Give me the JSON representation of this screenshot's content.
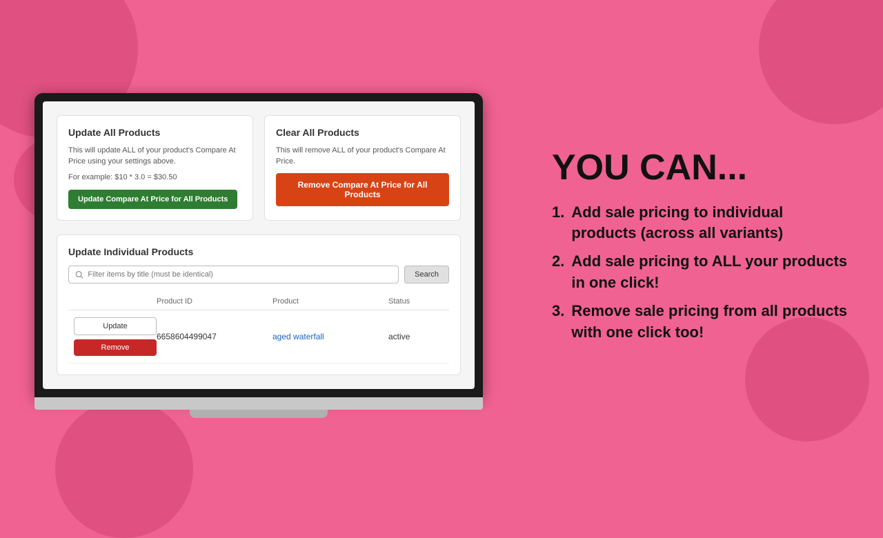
{
  "background": {
    "color": "#f06292"
  },
  "left": {
    "update_all": {
      "title": "Update All Products",
      "description": "This will update ALL of your product's Compare At Price using your settings above.",
      "example": "For example: $10 * 3.0 = $30.50",
      "button_label": "Update Compare At Price for All Products"
    },
    "clear_all": {
      "title": "Clear All Products",
      "description": "This will remove ALL of your product's Compare At Price.",
      "button_label": "Remove Compare At Price for All Products"
    },
    "individual": {
      "title": "Update Individual Products",
      "search_placeholder": "Filter items by title (must be identical)",
      "search_button": "Search",
      "columns": {
        "col1": "",
        "col2": "Product ID",
        "col3": "Product",
        "col4": "Status"
      },
      "rows": [
        {
          "update_label": "Update",
          "remove_label": "Remove",
          "product_id": "6658604499047",
          "product_name": "aged waterfall",
          "product_link": "#",
          "status": "active"
        }
      ]
    }
  },
  "right": {
    "heading": "YOU CAN...",
    "items": [
      "Add sale pricing to individual products (across all variants)",
      "Add sale pricing to ALL your products in one click!",
      "Remove sale pricing from all products with one click too!"
    ]
  }
}
